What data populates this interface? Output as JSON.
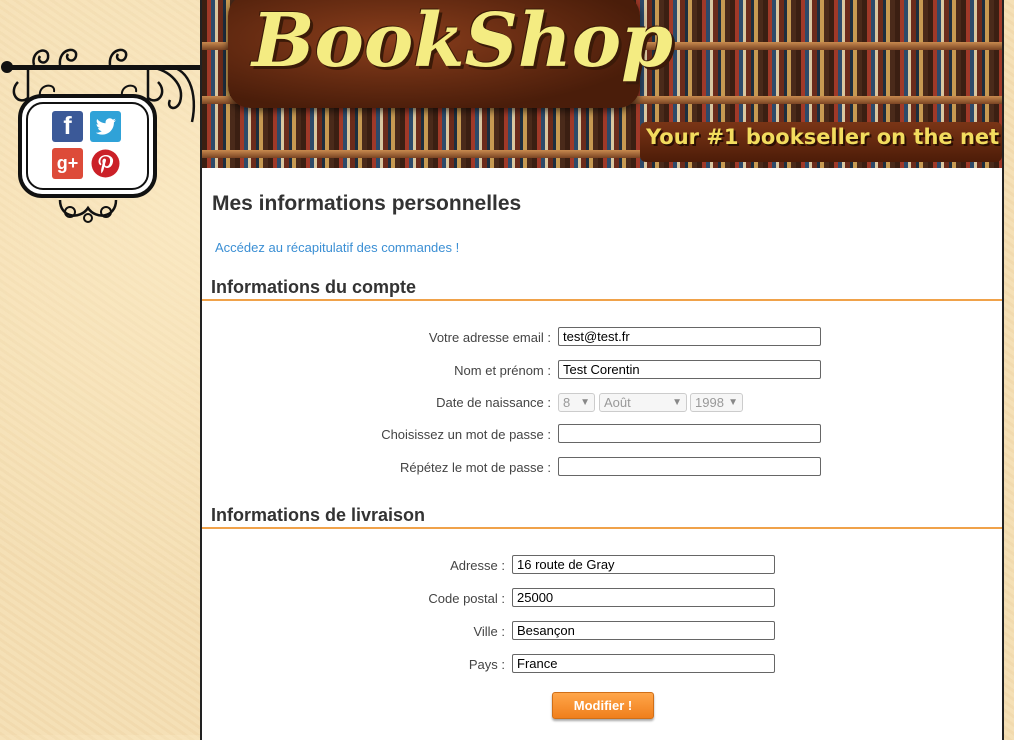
{
  "social": {
    "facebook": "f",
    "twitter_icon": "twitter-bird-icon",
    "googleplus": "g+",
    "pinterest_icon": "pinterest-icon"
  },
  "banner": {
    "logo": "BookShop",
    "tagline": "Your #1 bookseller on the net"
  },
  "page": {
    "title": "Mes informations personnelles",
    "orders_link": "Accédez au récapitulatif des commandes !"
  },
  "account": {
    "section_title": "Informations du compte",
    "email_label": "Votre adresse email :",
    "email_value": "test@test.fr",
    "name_label": "Nom et prénom :",
    "name_value": "Test Corentin",
    "birth_label": "Date de naissance :",
    "birth_day": "8",
    "birth_month": "Août",
    "birth_year": "1998",
    "password_label": "Choisissez un mot de passe :",
    "password_value": "",
    "repeat_label": "Répétez le mot de passe :",
    "repeat_value": ""
  },
  "delivery": {
    "section_title": "Informations de livraison",
    "address_label": "Adresse :",
    "address_value": "16 route de Gray",
    "postal_label": "Code postal :",
    "postal_value": "25000",
    "city_label": "Ville :",
    "city_value": "Besançon",
    "country_label": "Pays :",
    "country_value": "France"
  },
  "submit_label": "Modifier !",
  "colors": {
    "accent": "#f0a24a",
    "link": "#3b8fd4",
    "button": "#f28a25"
  }
}
